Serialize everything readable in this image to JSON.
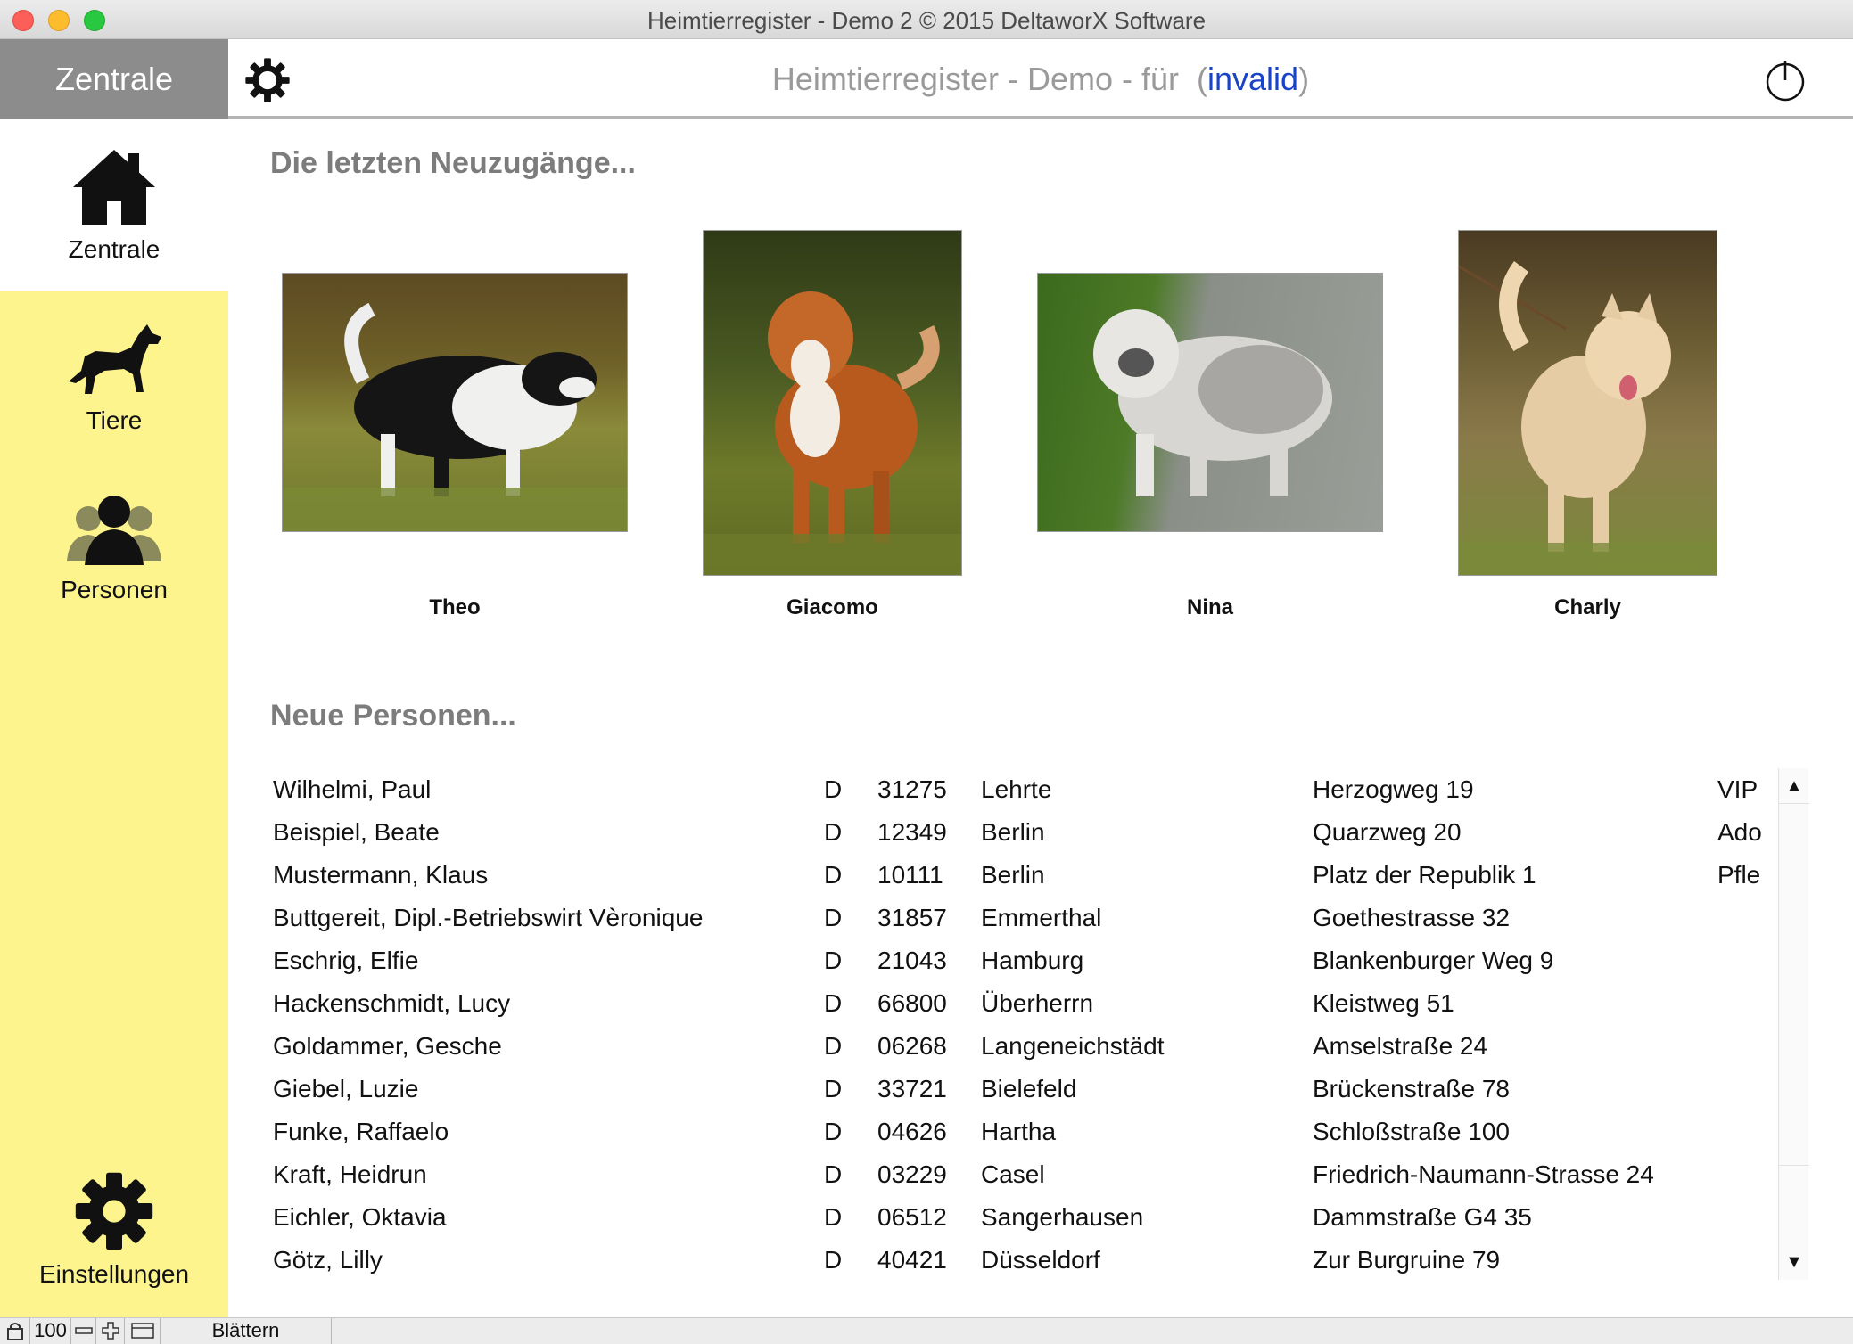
{
  "window": {
    "title": "Heimtierregister - Demo 2 © 2015 DeltaworX Software"
  },
  "toolbar": {
    "home_label": "Zentrale",
    "title_prefix": "Heimtierregister - Demo - für",
    "title_open": "(",
    "title_link": "invalid",
    "title_close": ")",
    "settings_icon": "gear-icon",
    "power_icon": "power-icon"
  },
  "sidebar": {
    "items": [
      {
        "label": "Zentrale",
        "icon": "house-icon",
        "active": true
      },
      {
        "label": "Tiere",
        "icon": "dog-icon",
        "active": false
      },
      {
        "label": "Personen",
        "icon": "people-icon",
        "active": false
      },
      {
        "label": "Einstellungen",
        "icon": "gear-icon",
        "active": false
      }
    ]
  },
  "recent": {
    "title": "Die letzten Neuzugänge...",
    "pets": [
      {
        "name": "Theo"
      },
      {
        "name": "Giacomo"
      },
      {
        "name": "Nina"
      },
      {
        "name": "Charly"
      }
    ]
  },
  "persons": {
    "title": "Neue Personen...",
    "rows": [
      {
        "name": "Wilhelmi,  Paul",
        "country": "D",
        "zip": "31275",
        "city": "Lehrte",
        "street": "Herzogweg 19",
        "tag": "VIP"
      },
      {
        "name": "Beispiel,  Beate",
        "country": "D",
        "zip": "12349",
        "city": "Berlin",
        "street": "Quarzweg 20",
        "tag": "Ado"
      },
      {
        "name": "Mustermann,  Klaus",
        "country": "D",
        "zip": "10111",
        "city": "Berlin",
        "street": "Platz der Republik 1",
        "tag": "Pfle"
      },
      {
        "name": "Buttgereit, Dipl.-Betriebswirt Vèronique",
        "country": "D",
        "zip": "31857",
        "city": "Emmerthal",
        "street": "Goethestrasse 32",
        "tag": ""
      },
      {
        "name": "Eschrig,  Elfie",
        "country": "D",
        "zip": "21043",
        "city": "Hamburg",
        "street": "Blankenburger Weg 9",
        "tag": ""
      },
      {
        "name": "Hackenschmidt,  Lucy",
        "country": "D",
        "zip": "66800",
        "city": "Überherrn",
        "street": "Kleistweg 51",
        "tag": ""
      },
      {
        "name": "Goldammer,  Gesche",
        "country": "D",
        "zip": "06268",
        "city": "Langeneichstädt",
        "street": "Amselstraße 24",
        "tag": ""
      },
      {
        "name": "Giebel,  Luzie",
        "country": "D",
        "zip": "33721",
        "city": "Bielefeld",
        "street": "Brückenstraße 78",
        "tag": ""
      },
      {
        "name": "Funke,  Raffaelo",
        "country": "D",
        "zip": "04626",
        "city": "Hartha",
        "street": "Schloßstraße 100",
        "tag": ""
      },
      {
        "name": "Kraft,  Heidrun",
        "country": "D",
        "zip": "03229",
        "city": "Casel",
        "street": "Friedrich-Naumann-Strasse 24",
        "tag": ""
      },
      {
        "name": "Eichler,  Oktavia",
        "country": "D",
        "zip": "06512",
        "city": "Sangerhausen",
        "street": "Dammstraße G4 35",
        "tag": ""
      },
      {
        "name": "Götz,  Lilly",
        "country": "D",
        "zip": "40421",
        "city": "Düsseldorf",
        "street": "Zur Burgruine 79",
        "tag": ""
      }
    ]
  },
  "scrollbar": {
    "up": "▲",
    "down": "▼"
  },
  "statusbar": {
    "zoom": "100",
    "mode": "Blättern"
  }
}
